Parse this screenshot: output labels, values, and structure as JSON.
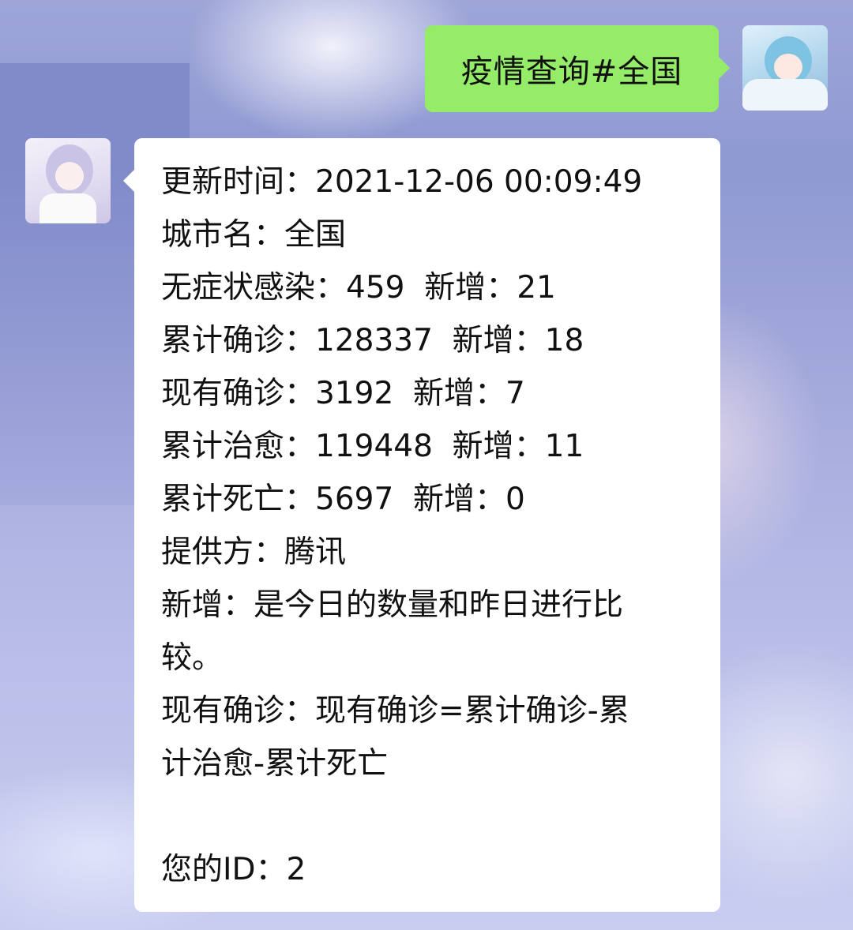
{
  "chat": {
    "outgoing_message": "疫情查询#全国",
    "incoming_lines": {
      "l1": "更新时间：2021-12-06 00:09:49",
      "l2": "城市名：全国",
      "l3": "无症状感染：459  新增：21",
      "l4": "累计确诊：128337  新增：18",
      "l5": "现有确诊：3192  新增：7",
      "l6": "累计治愈：119448  新增：11",
      "l7": "累计死亡：5697  新增：0",
      "l8": "提供方：腾讯",
      "l9a": "新增：是今日的数量和昨日进行比",
      "l9b": "较。",
      "l10a": "现有确诊：现有确诊=累计确诊-累",
      "l10b": "计治愈-累计死亡",
      "l11": "您的ID：2"
    }
  },
  "colors": {
    "outgoing_bubble": "#95ec69",
    "incoming_bubble": "#ffffff",
    "background": "#a6acdd"
  }
}
